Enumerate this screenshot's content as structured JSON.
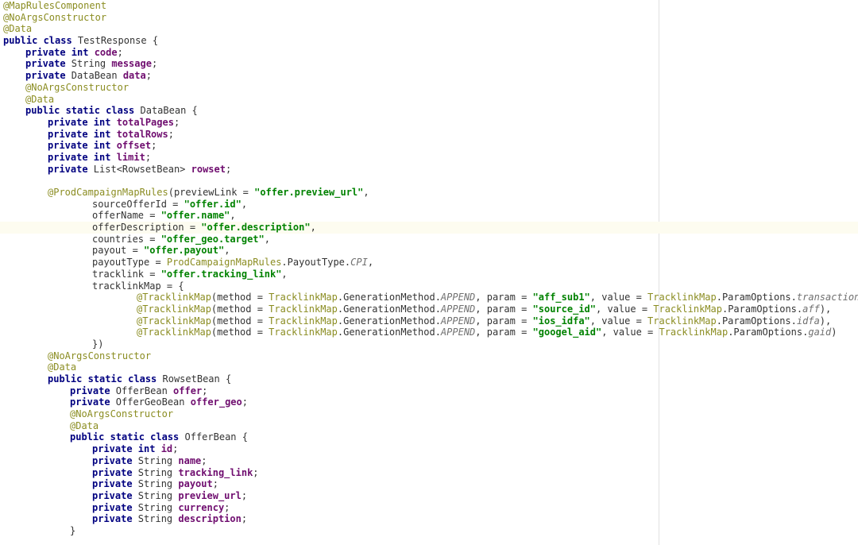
{
  "code": {
    "lines": [
      {
        "indent": 0,
        "tokens": [
          [
            "anno",
            "@MapRulesComponent"
          ]
        ]
      },
      {
        "indent": 0,
        "tokens": [
          [
            "anno",
            "@NoArgsConstructor"
          ]
        ]
      },
      {
        "indent": 0,
        "tokens": [
          [
            "anno",
            "@Data"
          ]
        ]
      },
      {
        "indent": 0,
        "tokens": [
          [
            "kw",
            "public class "
          ],
          [
            "ident",
            "TestResponse "
          ],
          [
            "punc",
            "{"
          ]
        ]
      },
      {
        "indent": 1,
        "tokens": [
          [
            "kw",
            "private int "
          ],
          [
            "field",
            "code"
          ],
          [
            "punc",
            ";"
          ]
        ]
      },
      {
        "indent": 1,
        "tokens": [
          [
            "kw",
            "private "
          ],
          [
            "ident",
            "String "
          ],
          [
            "field",
            "message"
          ],
          [
            "punc",
            ";"
          ]
        ]
      },
      {
        "indent": 1,
        "tokens": [
          [
            "kw",
            "private "
          ],
          [
            "ident",
            "DataBean "
          ],
          [
            "field",
            "data"
          ],
          [
            "punc",
            ";"
          ]
        ]
      },
      {
        "indent": 1,
        "tokens": [
          [
            "anno",
            "@NoArgsConstructor"
          ]
        ]
      },
      {
        "indent": 1,
        "tokens": [
          [
            "anno",
            "@Data"
          ]
        ]
      },
      {
        "indent": 1,
        "tokens": [
          [
            "kw",
            "public static class "
          ],
          [
            "ident",
            "DataBean "
          ],
          [
            "punc",
            "{"
          ]
        ]
      },
      {
        "indent": 2,
        "tokens": [
          [
            "kw",
            "private int "
          ],
          [
            "field",
            "totalPages"
          ],
          [
            "punc",
            ";"
          ]
        ]
      },
      {
        "indent": 2,
        "tokens": [
          [
            "kw",
            "private int "
          ],
          [
            "field",
            "totalRows"
          ],
          [
            "punc",
            ";"
          ]
        ]
      },
      {
        "indent": 2,
        "tokens": [
          [
            "kw",
            "private int "
          ],
          [
            "field",
            "offset"
          ],
          [
            "punc",
            ";"
          ]
        ]
      },
      {
        "indent": 2,
        "tokens": [
          [
            "kw",
            "private int "
          ],
          [
            "field",
            "limit"
          ],
          [
            "punc",
            ";"
          ]
        ]
      },
      {
        "indent": 2,
        "tokens": [
          [
            "kw",
            "private "
          ],
          [
            "ident",
            "List<RowsetBean> "
          ],
          [
            "field",
            "rowset"
          ],
          [
            "punc",
            ";"
          ]
        ]
      },
      {
        "indent": 2,
        "tokens": [
          [
            "ident",
            ""
          ]
        ]
      },
      {
        "indent": 2,
        "tokens": [
          [
            "anno",
            "@ProdCampaignMapRules"
          ],
          [
            "punc",
            "(previewLink = "
          ],
          [
            "str",
            "\"offer.preview_url\""
          ],
          [
            "punc",
            ","
          ]
        ]
      },
      {
        "indent": 4,
        "tokens": [
          [
            "ident",
            "sourceOfferId = "
          ],
          [
            "str",
            "\"offer.id\""
          ],
          [
            "punc",
            ","
          ]
        ]
      },
      {
        "indent": 4,
        "tokens": [
          [
            "ident",
            "offerName = "
          ],
          [
            "str",
            "\"offer.name\""
          ],
          [
            "punc",
            ","
          ]
        ]
      },
      {
        "indent": 4,
        "hl": true,
        "tokens": [
          [
            "ident",
            "offerDescription = "
          ],
          [
            "str",
            "\"offer.description\""
          ],
          [
            "punc",
            ","
          ]
        ]
      },
      {
        "indent": 4,
        "tokens": [
          [
            "ident",
            "countries = "
          ],
          [
            "str",
            "\"offer_geo.target\""
          ],
          [
            "punc",
            ","
          ]
        ]
      },
      {
        "indent": 4,
        "tokens": [
          [
            "ident",
            "payout = "
          ],
          [
            "str",
            "\"offer.payout\""
          ],
          [
            "punc",
            ","
          ]
        ]
      },
      {
        "indent": 4,
        "tokens": [
          [
            "ident",
            "payoutType = "
          ],
          [
            "anno",
            "ProdCampaignMapRules"
          ],
          [
            "punc",
            ".PayoutType."
          ],
          [
            "italic",
            "CPI"
          ],
          [
            "punc",
            ","
          ]
        ]
      },
      {
        "indent": 4,
        "tokens": [
          [
            "ident",
            "tracklink = "
          ],
          [
            "str",
            "\"offer.tracking_link\""
          ],
          [
            "punc",
            ","
          ]
        ]
      },
      {
        "indent": 4,
        "tokens": [
          [
            "ident",
            "tracklinkMap = {"
          ]
        ]
      },
      {
        "indent": 6,
        "tokens": [
          [
            "anno",
            "@TracklinkMap"
          ],
          [
            "punc",
            "(method = "
          ],
          [
            "anno",
            "TracklinkMap"
          ],
          [
            "punc",
            ".GenerationMethod."
          ],
          [
            "italic",
            "APPEND"
          ],
          [
            "punc",
            ", param = "
          ],
          [
            "str",
            "\"aff_sub1\""
          ],
          [
            "punc",
            ", value = "
          ],
          [
            "anno",
            "TracklinkMap"
          ],
          [
            "punc",
            ".ParamOptions."
          ],
          [
            "italic",
            "transaction_id"
          ],
          [
            "punc",
            "),"
          ]
        ]
      },
      {
        "indent": 6,
        "tokens": [
          [
            "anno",
            "@TracklinkMap"
          ],
          [
            "punc",
            "(method = "
          ],
          [
            "anno",
            "TracklinkMap"
          ],
          [
            "punc",
            ".GenerationMethod."
          ],
          [
            "italic",
            "APPEND"
          ],
          [
            "punc",
            ", param = "
          ],
          [
            "str",
            "\"source_id\""
          ],
          [
            "punc",
            ", value = "
          ],
          [
            "anno",
            "TracklinkMap"
          ],
          [
            "punc",
            ".ParamOptions."
          ],
          [
            "italic",
            "aff"
          ],
          [
            "punc",
            "),"
          ]
        ]
      },
      {
        "indent": 6,
        "tokens": [
          [
            "anno",
            "@TracklinkMap"
          ],
          [
            "punc",
            "(method = "
          ],
          [
            "anno",
            "TracklinkMap"
          ],
          [
            "punc",
            ".GenerationMethod."
          ],
          [
            "italic",
            "APPEND"
          ],
          [
            "punc",
            ", param = "
          ],
          [
            "str",
            "\"ios_idfa\""
          ],
          [
            "punc",
            ", value = "
          ],
          [
            "anno",
            "TracklinkMap"
          ],
          [
            "punc",
            ".ParamOptions."
          ],
          [
            "italic",
            "idfa"
          ],
          [
            "punc",
            "),"
          ]
        ]
      },
      {
        "indent": 6,
        "tokens": [
          [
            "anno",
            "@TracklinkMap"
          ],
          [
            "punc",
            "(method = "
          ],
          [
            "anno",
            "TracklinkMap"
          ],
          [
            "punc",
            ".GenerationMethod."
          ],
          [
            "italic",
            "APPEND"
          ],
          [
            "punc",
            ", param = "
          ],
          [
            "str",
            "\"googel_aid\""
          ],
          [
            "punc",
            ", value = "
          ],
          [
            "anno",
            "TracklinkMap"
          ],
          [
            "punc",
            ".ParamOptions."
          ],
          [
            "italic",
            "gaid"
          ],
          [
            "punc",
            ")"
          ]
        ]
      },
      {
        "indent": 4,
        "tokens": [
          [
            "punc",
            "})"
          ]
        ]
      },
      {
        "indent": 2,
        "tokens": [
          [
            "anno",
            "@NoArgsConstructor"
          ]
        ]
      },
      {
        "indent": 2,
        "tokens": [
          [
            "anno",
            "@Data"
          ]
        ]
      },
      {
        "indent": 2,
        "tokens": [
          [
            "kw",
            "public static class "
          ],
          [
            "ident",
            "RowsetBean "
          ],
          [
            "punc",
            "{"
          ]
        ]
      },
      {
        "indent": 3,
        "tokens": [
          [
            "kw",
            "private "
          ],
          [
            "ident",
            "OfferBean "
          ],
          [
            "field",
            "offer"
          ],
          [
            "punc",
            ";"
          ]
        ]
      },
      {
        "indent": 3,
        "tokens": [
          [
            "kw",
            "private "
          ],
          [
            "ident",
            "OfferGeoBean "
          ],
          [
            "field",
            "offer_geo"
          ],
          [
            "punc",
            ";"
          ]
        ]
      },
      {
        "indent": 3,
        "tokens": [
          [
            "anno",
            "@NoArgsConstructor"
          ]
        ]
      },
      {
        "indent": 3,
        "tokens": [
          [
            "anno",
            "@Data"
          ]
        ]
      },
      {
        "indent": 3,
        "tokens": [
          [
            "kw",
            "public static class "
          ],
          [
            "ident",
            "OfferBean "
          ],
          [
            "punc",
            "{"
          ]
        ]
      },
      {
        "indent": 4,
        "tokens": [
          [
            "kw",
            "private int "
          ],
          [
            "field",
            "id"
          ],
          [
            "punc",
            ";"
          ]
        ]
      },
      {
        "indent": 4,
        "tokens": [
          [
            "kw",
            "private "
          ],
          [
            "ident",
            "String "
          ],
          [
            "field",
            "name"
          ],
          [
            "punc",
            ";"
          ]
        ]
      },
      {
        "indent": 4,
        "tokens": [
          [
            "kw",
            "private "
          ],
          [
            "ident",
            "String "
          ],
          [
            "field",
            "tracking_link"
          ],
          [
            "punc",
            ";"
          ]
        ]
      },
      {
        "indent": 4,
        "tokens": [
          [
            "kw",
            "private "
          ],
          [
            "ident",
            "String "
          ],
          [
            "field",
            "payout"
          ],
          [
            "punc",
            ";"
          ]
        ]
      },
      {
        "indent": 4,
        "tokens": [
          [
            "kw",
            "private "
          ],
          [
            "ident",
            "String "
          ],
          [
            "field",
            "preview_url"
          ],
          [
            "punc",
            ";"
          ]
        ]
      },
      {
        "indent": 4,
        "tokens": [
          [
            "kw",
            "private "
          ],
          [
            "ident",
            "String "
          ],
          [
            "field",
            "currency"
          ],
          [
            "punc",
            ";"
          ]
        ]
      },
      {
        "indent": 4,
        "tokens": [
          [
            "kw",
            "private "
          ],
          [
            "ident",
            "String "
          ],
          [
            "field",
            "description"
          ],
          [
            "punc",
            ";"
          ]
        ]
      },
      {
        "indent": 3,
        "tokens": [
          [
            "punc",
            "}"
          ]
        ]
      }
    ]
  },
  "bulb_line_index": 19
}
